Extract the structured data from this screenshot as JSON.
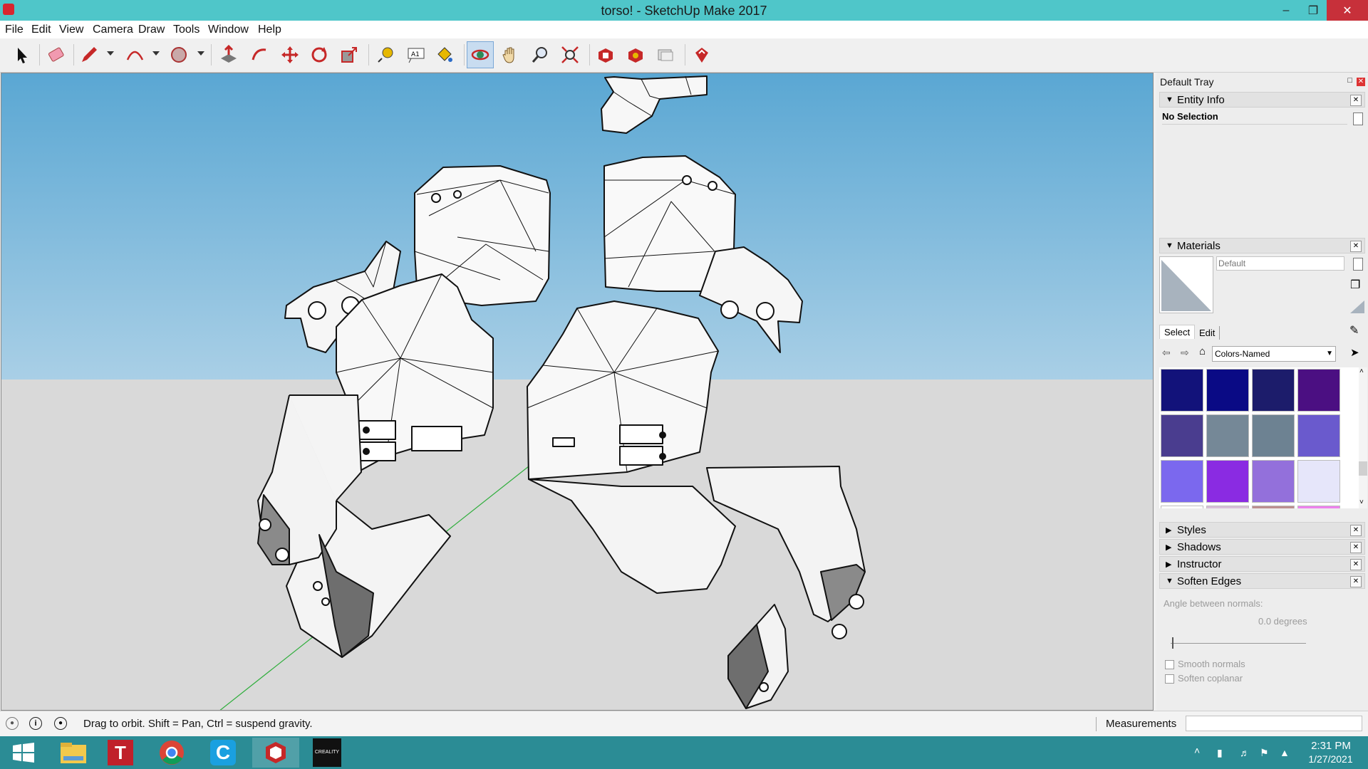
{
  "window": {
    "title": "torso! - SketchUp Make 2017"
  },
  "menu": [
    "File",
    "Edit",
    "View",
    "Camera",
    "Draw",
    "Tools",
    "Window",
    "Help"
  ],
  "tray": {
    "title": "Default Tray",
    "entity_info": {
      "title": "Entity Info",
      "selection": "No Selection"
    },
    "materials": {
      "title": "Materials",
      "name_placeholder": "Default",
      "tabs": [
        "Select",
        "Edit"
      ],
      "library": "Colors-Named",
      "swatches": [
        "#12127a",
        "#0a0a85",
        "#1c1c6b",
        "#4b0f82",
        "#4a3d8f",
        "#758897",
        "#6d8292",
        "#6a5acd",
        "#7b68ee",
        "#8a2be2",
        "#9370db",
        "#e6e6fa"
      ]
    },
    "panels": {
      "styles": "Styles",
      "shadows": "Shadows",
      "instructor": "Instructor",
      "soften": "Soften Edges"
    },
    "soften_edges": {
      "angle_label": "Angle between normals:",
      "angle_value": "0.0  degrees",
      "smooth": "Smooth normals",
      "coplanar": "Soften coplanar"
    }
  },
  "status": {
    "hint": "Drag to orbit. Shift = Pan, Ctrl = suspend gravity.",
    "measurements_label": "Measurements"
  },
  "taskbar": {
    "time": "2:31 PM",
    "date": "1/27/2021",
    "crealty": "CREALITY"
  }
}
